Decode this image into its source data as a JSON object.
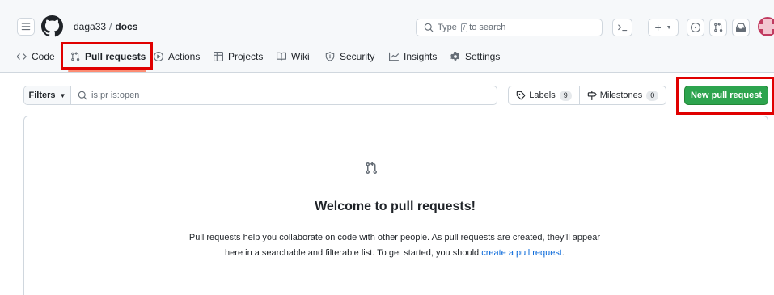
{
  "header": {
    "owner": "daga33",
    "separator": "/",
    "repo": "docs",
    "search": {
      "prefix": "Type",
      "key": "/",
      "suffix": "to search"
    },
    "command_palette_label": ">_",
    "create_label": "+"
  },
  "tabs": [
    {
      "label": "Code",
      "icon": "code-icon"
    },
    {
      "label": "Pull requests",
      "icon": "git-pull-request-icon",
      "active": true
    },
    {
      "label": "Actions",
      "icon": "play-icon"
    },
    {
      "label": "Projects",
      "icon": "table-icon"
    },
    {
      "label": "Wiki",
      "icon": "book-icon"
    },
    {
      "label": "Security",
      "icon": "shield-icon"
    },
    {
      "label": "Insights",
      "icon": "graph-icon"
    },
    {
      "label": "Settings",
      "icon": "gear-icon"
    }
  ],
  "toolbar": {
    "filters_label": "Filters",
    "filter_value": "is:pr is:open",
    "labels_label": "Labels",
    "labels_count": "9",
    "milestones_label": "Milestones",
    "milestones_count": "0",
    "new_pr_label": "New pull request"
  },
  "blankslate": {
    "title": "Welcome to pull requests!",
    "text_before": "Pull requests help you collaborate on code with other people. As pull requests are created, they’ll appear here in a searchable and filterable list. To get started, you should ",
    "link_text": "create a pull request",
    "text_after": "."
  },
  "colors": {
    "accent_green": "#2da44e",
    "link_blue": "#0969da",
    "highlight_red": "#e00000",
    "tab_underline": "#fd8c73"
  }
}
